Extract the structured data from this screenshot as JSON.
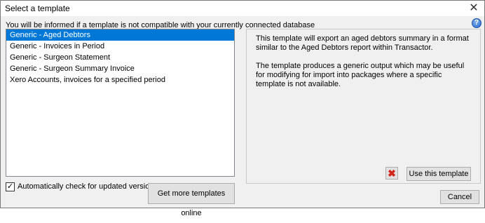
{
  "window": {
    "title": "Select a template",
    "close_glyph": "✕"
  },
  "info_text": "You will be informed if a template is not compatible with your currently connected database",
  "help_icon": {
    "icon": "help-icon",
    "glyph": "?"
  },
  "templates": [
    {
      "label": "Generic - Aged Debtors",
      "selected": true
    },
    {
      "label": "Generic - Invoices in Period",
      "selected": false
    },
    {
      "label": "Generic - Surgeon Statement",
      "selected": false
    },
    {
      "label": "Generic - Surgeon Summary Invoice",
      "selected": false
    },
    {
      "label": "Xero Accounts, invoices for a specified period",
      "selected": false
    }
  ],
  "auto_check": {
    "label": "Automatically check for updated versions online",
    "checked": true,
    "check_glyph": "✓"
  },
  "buttons": {
    "more_templates": "Get more templates online",
    "use_template": "Use this template",
    "cancel": "Cancel",
    "delete_glyph": "✖"
  },
  "description": {
    "paragraph1": "This template will export an aged debtors summary in a format similar to the Aged Debtors report within Transactor.",
    "paragraph2": "The template produces a generic output which may be useful for modifying for import into packages where a specific template is not available."
  },
  "colors": {
    "selection": "#0078d7",
    "delete_icon": "#d0261c",
    "help_icon": "#2a68c8"
  }
}
